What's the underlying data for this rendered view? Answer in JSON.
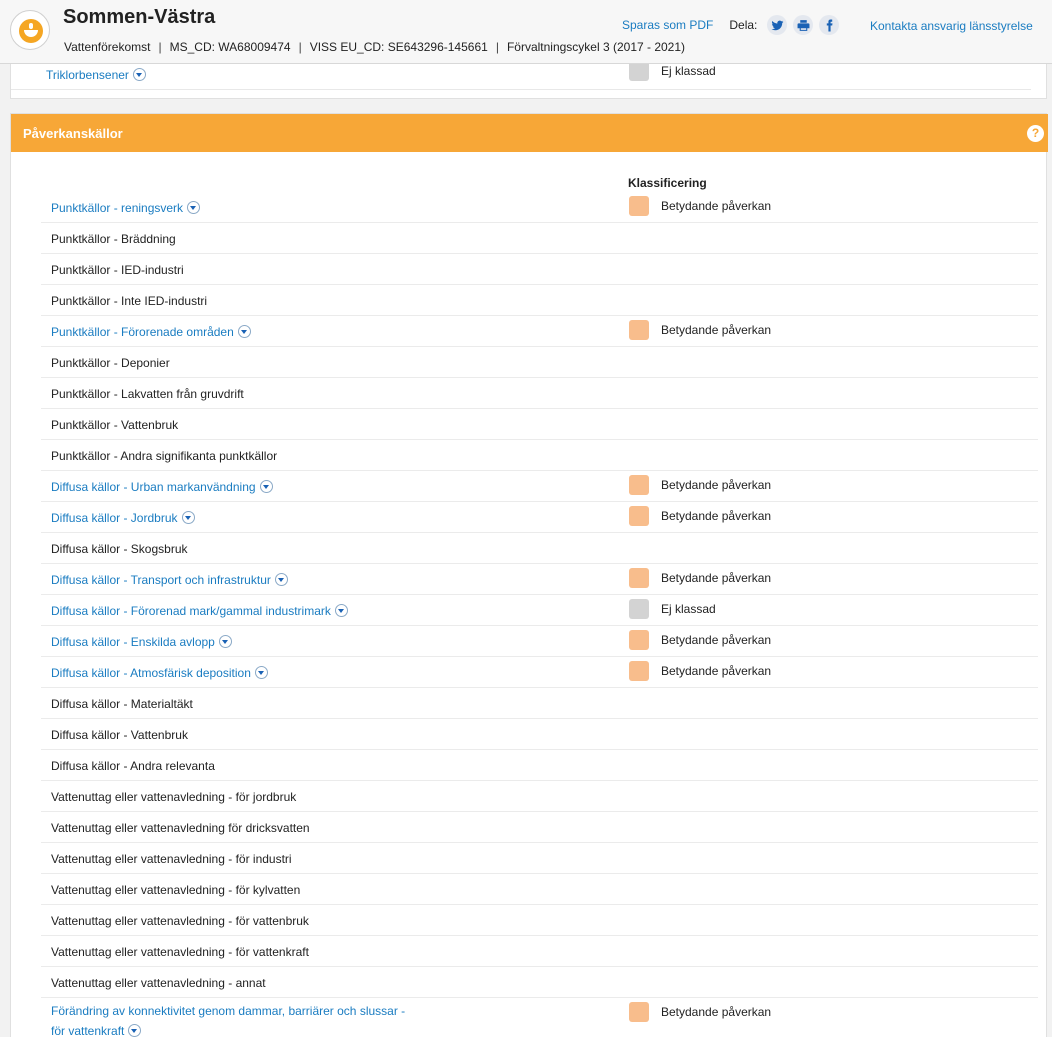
{
  "header": {
    "title": "Sommen-Västra",
    "subtitle_parts": [
      "Vattenförekomst",
      "MS_CD: WA68009474",
      "VISS EU_CD: SE643296-145661",
      "Förvaltningscykel 3 (2017 - 2021)"
    ],
    "save_pdf": "Sparas som PDF",
    "share_label": "Dela:",
    "contact": "Kontakta ansvarig länsstyrelse",
    "share_icons": [
      "twitter-icon",
      "print-icon",
      "facebook-icon"
    ]
  },
  "prev_panel": {
    "row": {
      "name": "Triklorbensener",
      "classification": "Ej klassad",
      "color": "#d3d3d3"
    }
  },
  "panel": {
    "title": "Påverkanskällor",
    "help_glyph": "?",
    "col_header": "Klassificering"
  },
  "colors": {
    "significant": "#f8bd8c",
    "unclassified": "#d3d3d3",
    "header_orange": "#f7a737",
    "link": "#1a7cc1"
  },
  "rows": [
    {
      "name": "Punktkällor - reningsverk",
      "link": true,
      "classification": "Betydande påverkan",
      "color": "#f8bd8c"
    },
    {
      "name": "Punktkällor - Bräddning",
      "link": false
    },
    {
      "name": "Punktkällor - IED-industri",
      "link": false
    },
    {
      "name": "Punktkällor - Inte IED-industri",
      "link": false
    },
    {
      "name": "Punktkällor - Förorenade områden",
      "link": true,
      "classification": "Betydande påverkan",
      "color": "#f8bd8c"
    },
    {
      "name": "Punktkällor - Deponier",
      "link": false
    },
    {
      "name": "Punktkällor - Lakvatten från gruvdrift",
      "link": false
    },
    {
      "name": "Punktkällor - Vattenbruk",
      "link": false
    },
    {
      "name": "Punktkällor - Andra signifikanta punktkällor",
      "link": false
    },
    {
      "name": "Diffusa källor - Urban markanvändning",
      "link": true,
      "classification": "Betydande påverkan",
      "color": "#f8bd8c"
    },
    {
      "name": "Diffusa källor - Jordbruk",
      "link": true,
      "classification": "Betydande påverkan",
      "color": "#f8bd8c"
    },
    {
      "name": "Diffusa källor - Skogsbruk",
      "link": false
    },
    {
      "name": "Diffusa källor - Transport och infrastruktur",
      "link": true,
      "classification": "Betydande påverkan",
      "color": "#f8bd8c"
    },
    {
      "name": "Diffusa källor - Förorenad mark/gammal industrimark",
      "link": true,
      "classification": "Ej klassad",
      "color": "#d3d3d3"
    },
    {
      "name": "Diffusa källor - Enskilda avlopp",
      "link": true,
      "classification": "Betydande påverkan",
      "color": "#f8bd8c"
    },
    {
      "name": "Diffusa källor - Atmosfärisk deposition",
      "link": true,
      "classification": "Betydande påverkan",
      "color": "#f8bd8c"
    },
    {
      "name": "Diffusa källor - Materialtäkt",
      "link": false
    },
    {
      "name": "Diffusa källor - Vattenbruk",
      "link": false
    },
    {
      "name": "Diffusa källor - Andra relevanta",
      "link": false
    },
    {
      "name": "Vattenuttag eller vattenavledning - för jordbruk",
      "link": false
    },
    {
      "name": "Vattenuttag eller vattenavledning för dricksvatten",
      "link": false
    },
    {
      "name": "Vattenuttag eller vattenavledning - för industri",
      "link": false
    },
    {
      "name": "Vattenuttag eller vattenavledning - för kylvatten",
      "link": false
    },
    {
      "name": "Vattenuttag eller vattenavledning - för vattenbruk",
      "link": false
    },
    {
      "name": "Vattenuttag eller vattenavledning - för vattenkraft",
      "link": false
    },
    {
      "name": "Vattenuttag eller vattenavledning - annat",
      "link": false
    },
    {
      "name": "Förändring av konnektivitet genom dammar, barriärer och slussar - för vattenkraft",
      "link": true,
      "classification": "Betydande påverkan",
      "color": "#f8bd8c",
      "tall": true
    }
  ]
}
